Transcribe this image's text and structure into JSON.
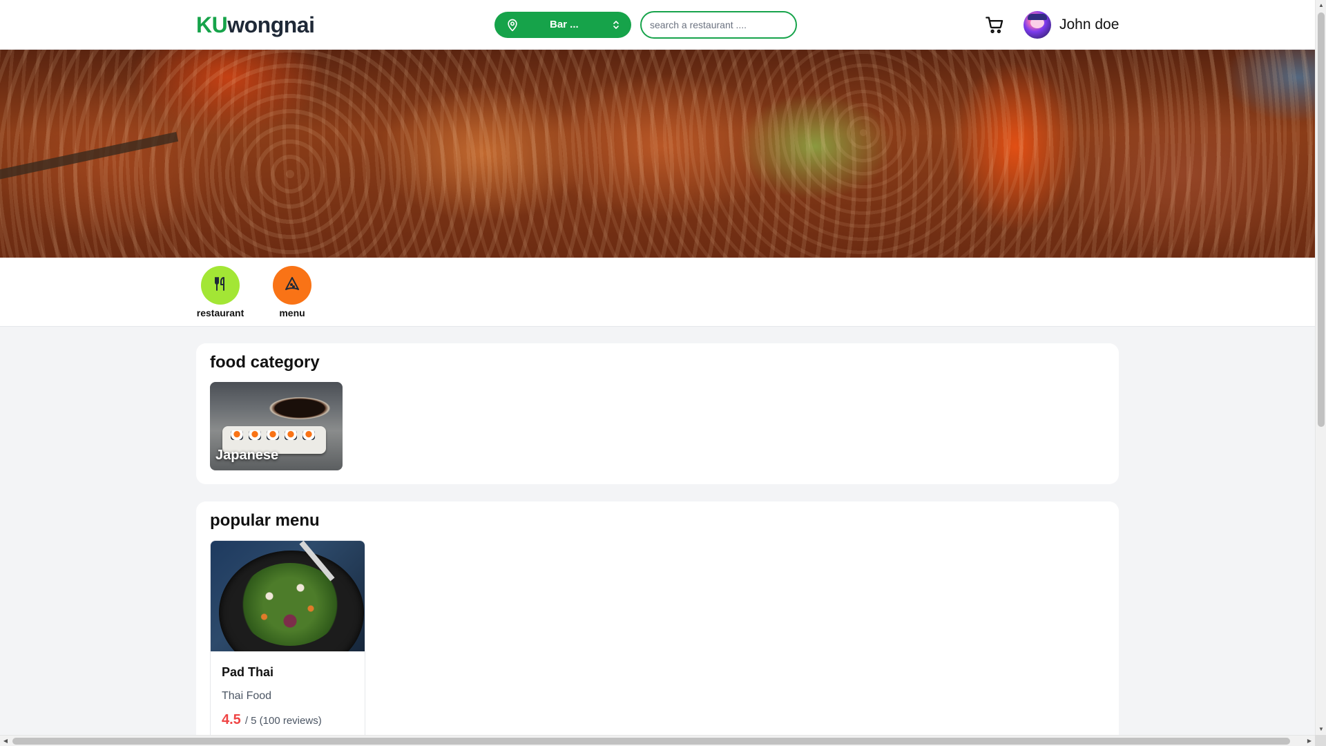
{
  "header": {
    "logo_accent": "KU",
    "logo_rest": "wongnai",
    "location_value": "Bar ...",
    "search_placeholder": "search a restaurant ....",
    "username": "John doe",
    "icons": [
      "location-pin-icon",
      "chevron-updown-icon",
      "cart-icon",
      "avatar"
    ]
  },
  "shortcuts": [
    {
      "label": "restaurant",
      "icon": "fork-knife-icon",
      "color": "#a3e635"
    },
    {
      "label": "menu",
      "icon": "pizza-slice-icon",
      "color": "#f97316"
    }
  ],
  "food_category": {
    "title": "food category",
    "items": [
      {
        "name": "Japanese"
      }
    ]
  },
  "popular_menu": {
    "title": "popular menu",
    "items": [
      {
        "name": "Pad Thai",
        "type": "Thai Food",
        "rating": "4.5",
        "rating_suffix": "/ 5 (100 reviews)"
      }
    ]
  },
  "colors": {
    "brand": "#16a34a",
    "rating": "#ef4444",
    "page_bg": "#f3f4f6"
  }
}
